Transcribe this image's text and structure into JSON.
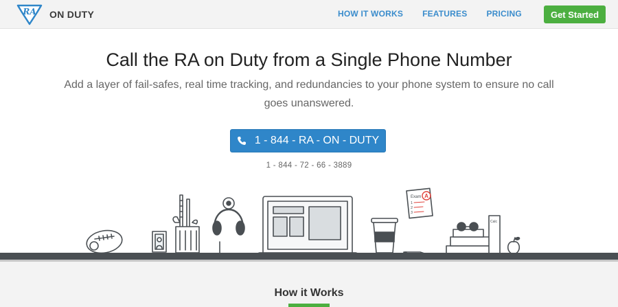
{
  "nav": {
    "logo_text": "ON DUTY",
    "logo_mark": "RA",
    "links": [
      "HOW IT WORKS",
      "FEATURES",
      "PRICING"
    ],
    "cta": "Get Started"
  },
  "hero": {
    "title": "Call the RA on Duty from a Single Phone Number",
    "subtitle": "Add a layer of fail-safes, real time tracking, and redundancies to your phone system to ensure no call goes unanswered.",
    "phone_button": "1 - 844 - RA - ON - DUTY",
    "phone_numeric": "1 - 844 - 72 - 66 - 3889"
  },
  "illustration": {
    "exam_label": "Exam",
    "exam_grade": "A",
    "exam_items": [
      "1",
      "2",
      "3"
    ],
    "book_label": "Calc"
  },
  "section": {
    "title": "How it Works"
  },
  "colors": {
    "accent_blue": "#2f86c9",
    "accent_green": "#4caf40",
    "nav_link": "#3a8ccc"
  }
}
